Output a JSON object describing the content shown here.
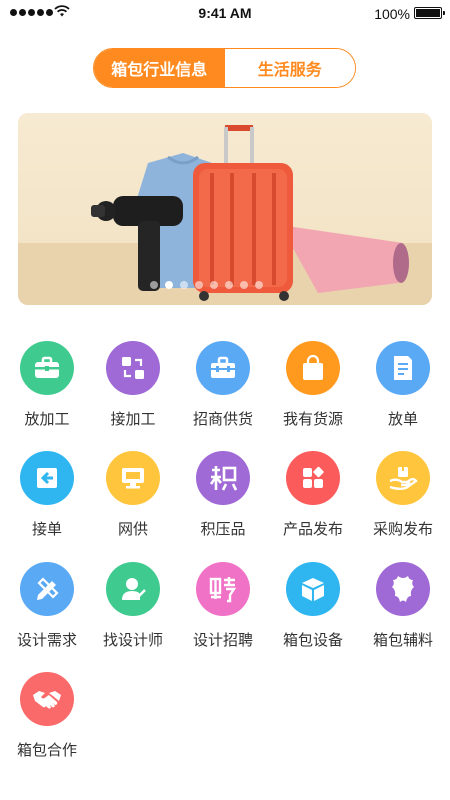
{
  "status_bar": {
    "time": "9:41 AM",
    "battery": "100%"
  },
  "tabs": [
    {
      "label": "箱包行业信息",
      "active": true
    },
    {
      "label": "生活服务",
      "active": false
    }
  ],
  "banner": {
    "slides": 8,
    "active_slide": 1
  },
  "menu": [
    {
      "label": "放加工",
      "icon": "briefcase-icon",
      "color": "#3fcb8f"
    },
    {
      "label": "接加工",
      "icon": "exchange-icon",
      "color": "#a06ad6"
    },
    {
      "label": "招商供货",
      "icon": "toolbox-icon",
      "color": "#5aa9f5"
    },
    {
      "label": "我有货源",
      "icon": "shopping-bag-icon",
      "color": "#ff9a1f"
    },
    {
      "label": "放单",
      "icon": "document-icon",
      "color": "#5aa9f5"
    },
    {
      "label": "接单",
      "icon": "login-icon",
      "color": "#2fb6f0"
    },
    {
      "label": "网供",
      "icon": "monitor-icon",
      "color": "#ffc53d"
    },
    {
      "label": "积压品",
      "icon": "stock-icon",
      "color": "#a06ad6"
    },
    {
      "label": "产品发布",
      "icon": "apps-icon",
      "color": "#fb5b5b"
    },
    {
      "label": "采购发布",
      "icon": "hand-box-icon",
      "color": "#ffc53d"
    },
    {
      "label": "设计需求",
      "icon": "pencil-ruler-icon",
      "color": "#5aa9f5"
    },
    {
      "label": "找设计师",
      "icon": "designer-icon",
      "color": "#3fcb8f"
    },
    {
      "label": "设计招聘",
      "icon": "recruit-icon",
      "color": "#f072c6"
    },
    {
      "label": "箱包设备",
      "icon": "cube-icon",
      "color": "#2fb6f0"
    },
    {
      "label": "箱包辅料",
      "icon": "leather-icon",
      "color": "#a06ad6"
    },
    {
      "label": "箱包合作",
      "icon": "handshake-icon",
      "color": "#fb6a6a"
    }
  ]
}
